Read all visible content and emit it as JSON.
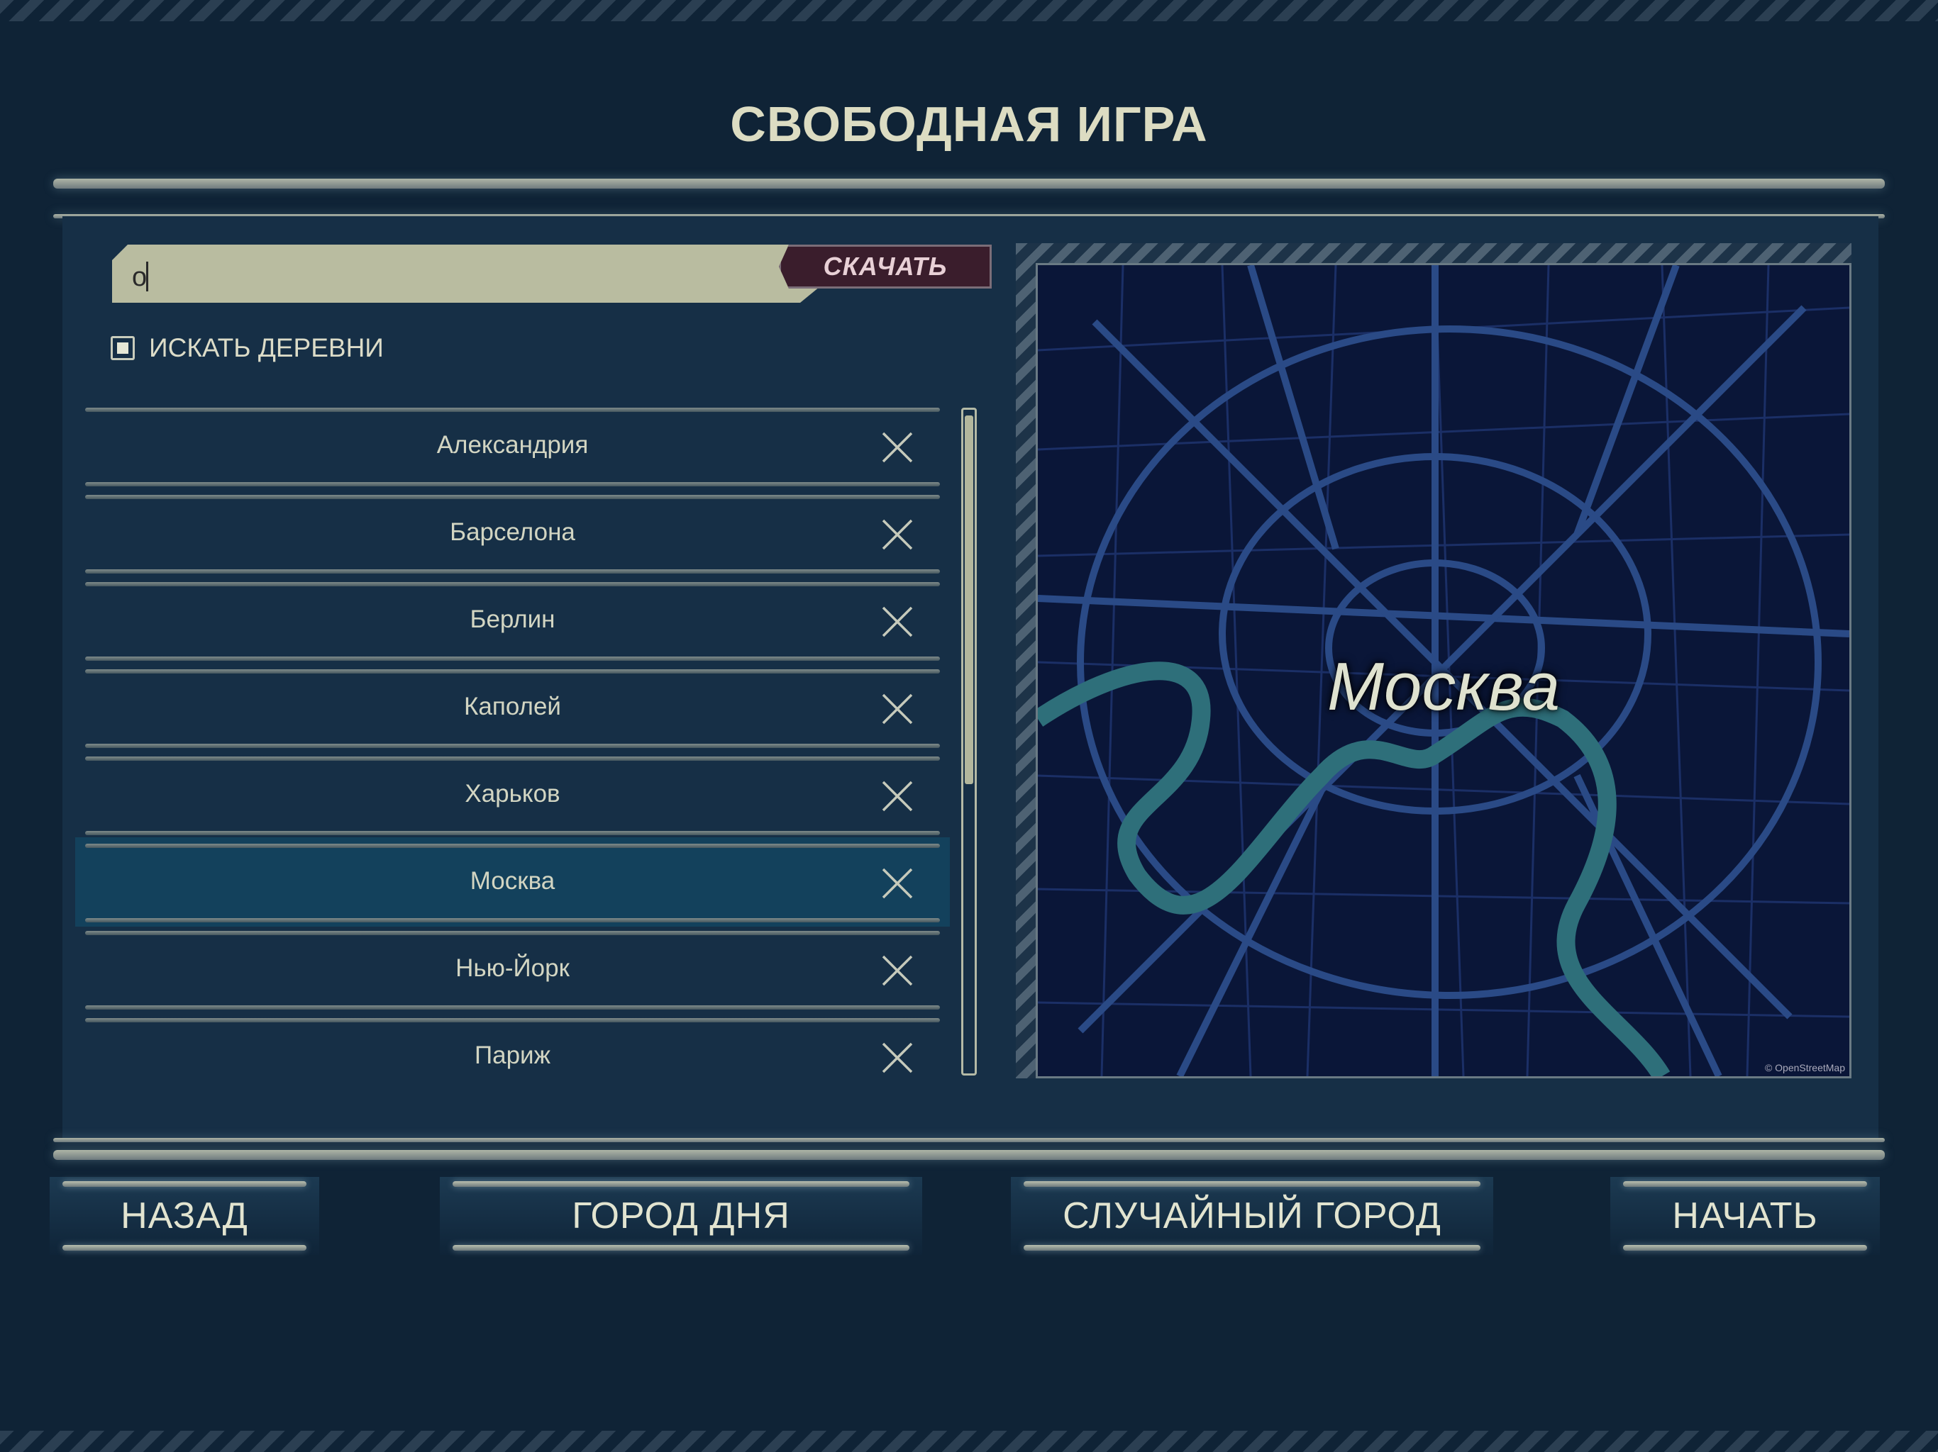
{
  "title": "СВОБОДНАЯ ИГРА",
  "search": {
    "value": "о",
    "download_label": "СКАЧАТЬ"
  },
  "village_search": {
    "label": "ИСКАТЬ ДЕРЕВНИ",
    "checked": true
  },
  "cities": [
    {
      "name": "Александрия"
    },
    {
      "name": "Барселона"
    },
    {
      "name": "Берлин"
    },
    {
      "name": "Каполей"
    },
    {
      "name": "Харьков"
    },
    {
      "name": "Москва",
      "selected": true
    },
    {
      "name": "Нью-Йорк"
    },
    {
      "name": "Париж"
    }
  ],
  "map": {
    "city_name": "Москва",
    "credit": "© OpenStreetMap"
  },
  "buttons": {
    "back": "НАЗАД",
    "city_of_day": "ГОРОД ДНЯ",
    "random_city": "СЛУЧАЙНЫЙ ГОРОД",
    "start": "НАЧАТЬ"
  },
  "colors": {
    "background": "#0f2336",
    "panel": "#162f46",
    "selected_row": "#13415c",
    "map_water": "#2e6f7a",
    "map_roads": "#2a4a86"
  }
}
